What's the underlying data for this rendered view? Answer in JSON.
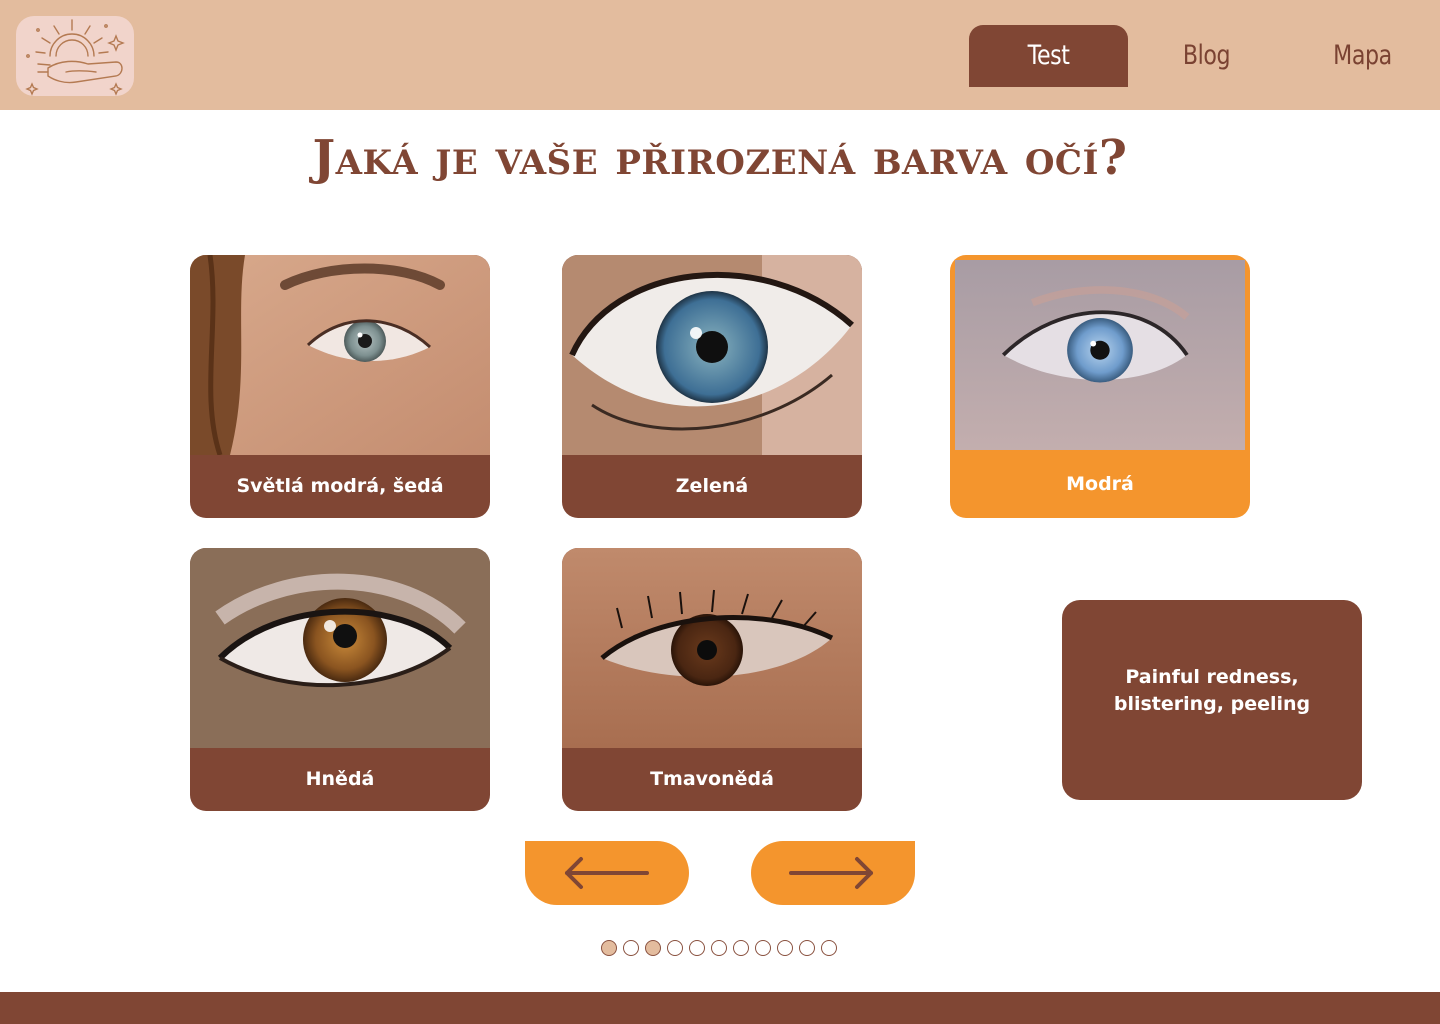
{
  "header": {
    "logo_icon": "sun-hand-icon",
    "nav": [
      {
        "label": "Test",
        "active": true
      },
      {
        "label": "Blog",
        "active": false
      },
      {
        "label": "Mapa",
        "active": false
      }
    ]
  },
  "main": {
    "title": "Jaká je vaše přirozená barva očí?",
    "options": [
      {
        "label": "Světlá modrá, šedá",
        "selected": false
      },
      {
        "label": "Zelená",
        "selected": false
      },
      {
        "label": "Modrá",
        "selected": true
      },
      {
        "label": "Hnědá",
        "selected": false
      },
      {
        "label": "Tmavonědá",
        "selected": false
      }
    ],
    "info_text": "Painful redness, blistering, peeling",
    "prev_icon": "arrow-left-icon",
    "next_icon": "arrow-right-icon"
  },
  "pagination": {
    "total": 11,
    "filled": [
      1,
      3
    ]
  },
  "colors": {
    "brown": "#804634",
    "peach": "#e3bc9e",
    "orange": "#f4952d"
  }
}
